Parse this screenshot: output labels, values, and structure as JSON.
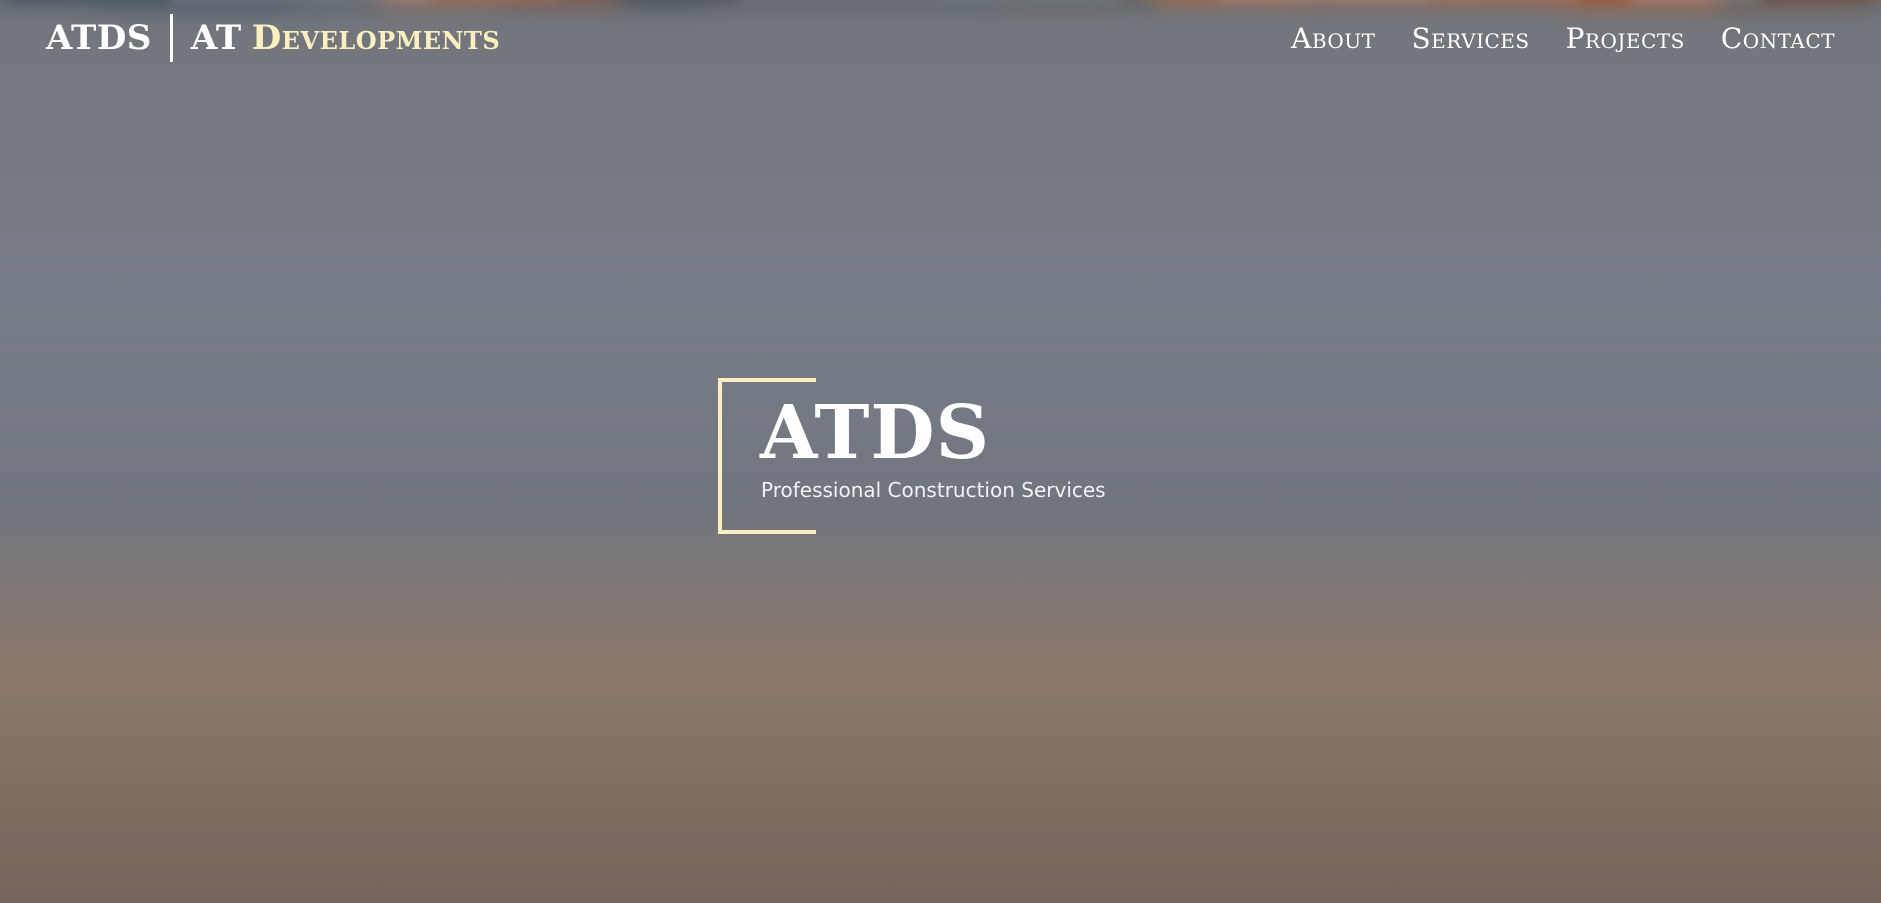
{
  "brand": {
    "short": "ATDS",
    "full_prefix": "AT",
    "full_rest": "Developments"
  },
  "nav": {
    "items": [
      {
        "label": "About"
      },
      {
        "label": "Services"
      },
      {
        "label": "Projects"
      },
      {
        "label": "Contact"
      }
    ]
  },
  "hero": {
    "title": "ATDS",
    "subtitle": "Professional Construction Services"
  },
  "colors": {
    "accent": "#fbefc0",
    "text": "#ffffff"
  }
}
